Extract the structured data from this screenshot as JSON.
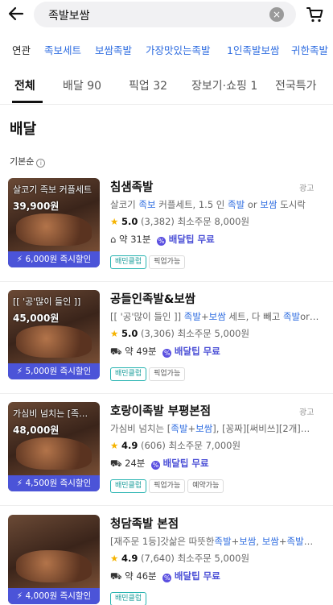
{
  "search": {
    "query": "족발보쌈",
    "clear_glyph": "×"
  },
  "icons": {
    "back": "arrow-left-icon",
    "clear": "clear-icon",
    "cart": "cart-icon"
  },
  "related": {
    "label": "연관",
    "keywords": [
      "족보세트",
      "보쌈족발",
      "가장맛있는족발",
      "1인족발보쌈",
      "귀한족발"
    ]
  },
  "tabs": [
    {
      "label": "전체",
      "count": ""
    },
    {
      "label": "배달",
      "count": "90"
    },
    {
      "label": "픽업",
      "count": "32"
    },
    {
      "label": "장보기·쇼핑",
      "count": "1"
    },
    {
      "label": "전국특가",
      "count": ""
    }
  ],
  "section": {
    "title": "배달",
    "sort_label": "기본순",
    "info_glyph": "i"
  },
  "colors": {
    "accent": "#2f6de0",
    "discount": "#4b54d8",
    "tip": "#4b4fd6",
    "star": "#f5b300"
  },
  "stores": [
    {
      "name": "침샘족발",
      "ad": "광고",
      "thumb_caption": "살코기 족보 커플세트",
      "thumb_price": "39,900원",
      "discount": "6,000원 즉시할인",
      "desc_parts": [
        "살코기 ",
        "족보",
        " 커플세트, 1.5 인 ",
        "족발",
        " or ",
        "보쌈",
        " 도시락"
      ],
      "rating": "5.0",
      "reviews": "(3,382)",
      "min_order_label": "최소주문",
      "min_order": "8,000원",
      "eta_prefix": "약",
      "eta": "31분",
      "tip_label": "배달팁 무료",
      "badges": [
        "배민클럽",
        "픽업가능"
      ]
    },
    {
      "name": "공들인족발&보쌈",
      "ad": "",
      "thumb_caption": "[[ '공'많이 들인 ]]",
      "thumb_price": "45,000원",
      "discount": "5,000원 즉시할인",
      "desc_parts": [
        "[[ '공'많이 들인 ]] ",
        "족발",
        "+",
        "보쌈",
        " 세트, 다 빼고 ",
        "족발",
        "or…"
      ],
      "rating": "5.0",
      "reviews": "(3,306)",
      "min_order_label": "최소주문",
      "min_order": "5,000원",
      "eta_prefix": "약",
      "eta": "49분",
      "tip_label": "배달팁 무료",
      "badges": [
        "배민클럽",
        "픽업가능"
      ]
    },
    {
      "name": "호랑이족발 부평본점",
      "ad": "광고",
      "thumb_caption": "가심비 넘치는 [족…",
      "thumb_price": "48,000원",
      "discount": "4,500원 즉시할인",
      "desc_parts": [
        "가심비 넘치는 [",
        "족발",
        "+",
        "보쌈",
        "], [꽁짜][써비쓰][2개]…"
      ],
      "rating": "4.9",
      "reviews": "(606)",
      "min_order_label": "최소주문",
      "min_order": "7,000원",
      "eta_prefix": "",
      "eta": "24분",
      "tip_label": "배달팁 무료",
      "badges": [
        "배민클럽",
        "픽업가능",
        "예약가능"
      ]
    },
    {
      "name": "청담족발 본점",
      "ad": "",
      "thumb_caption": "",
      "thumb_price": "",
      "discount": "4,000원 즉시할인",
      "desc_parts": [
        "[재주문 1등]갓삶은 따뜻한",
        "족발",
        "+",
        "보쌈",
        ", ",
        "보쌈",
        "+",
        "족발",
        "…"
      ],
      "rating": "4.9",
      "reviews": "(7,640)",
      "min_order_label": "최소주문",
      "min_order": "5,000원",
      "eta_prefix": "약",
      "eta": "46분",
      "tip_label": "배달팁 무료",
      "badges": [
        "배민클럽"
      ]
    }
  ]
}
